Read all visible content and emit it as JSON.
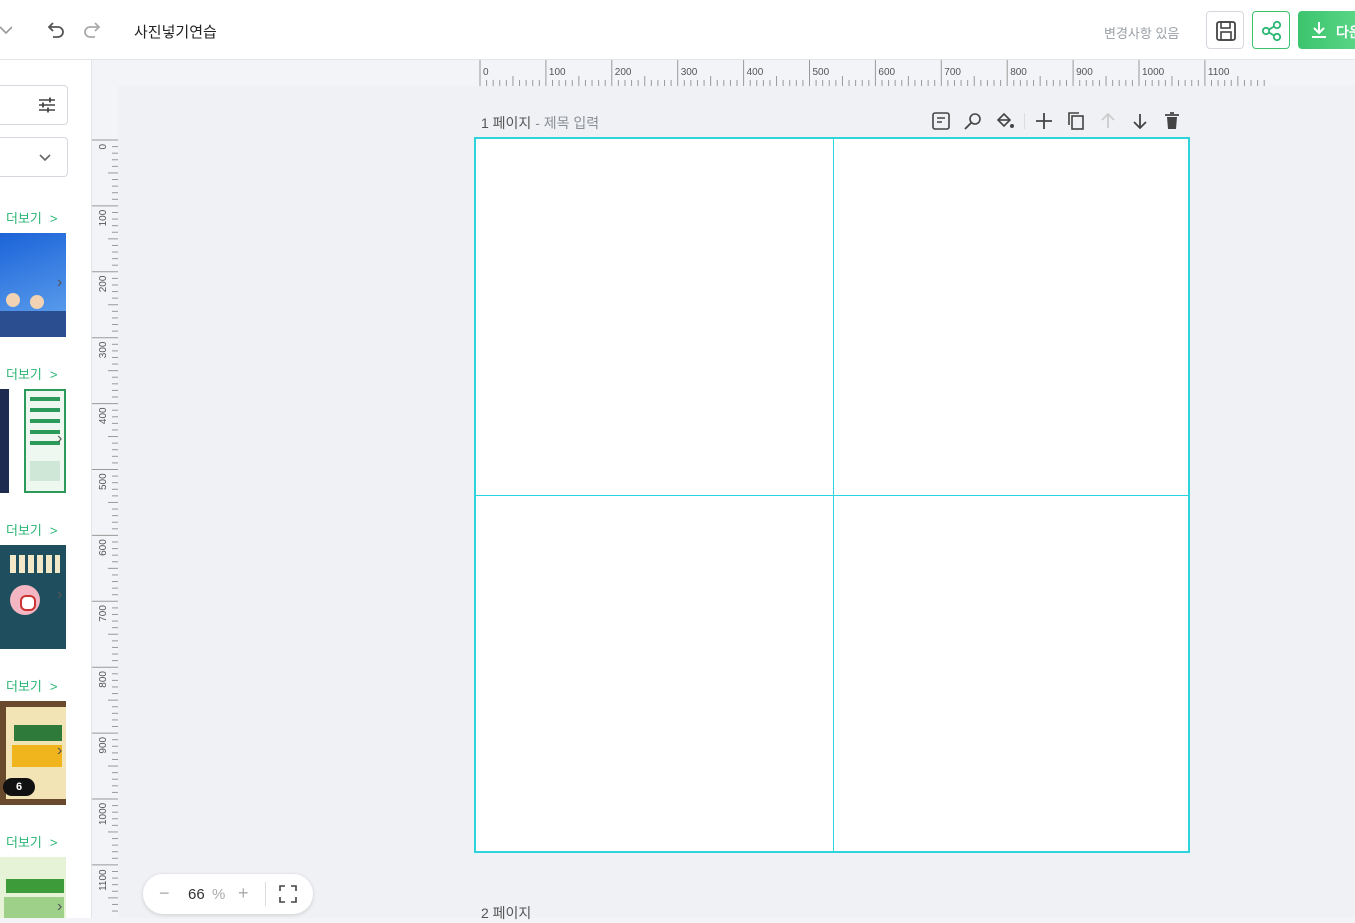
{
  "header": {
    "title": "사진넣기연습",
    "status": "변경사항 있음",
    "download_label": "다운"
  },
  "sidebar": {
    "more_label": "더보기",
    "badge_count": "6"
  },
  "rulers": {
    "horizontal": [
      "0",
      "100",
      "200",
      "300",
      "400",
      "500",
      "600",
      "700",
      "800",
      "900",
      "1000",
      "1100"
    ],
    "vertical": [
      "0",
      "100",
      "200",
      "300",
      "400",
      "500",
      "600",
      "700",
      "800",
      "900",
      "1000",
      "1100"
    ]
  },
  "page1": {
    "number": "1 페이지",
    "title_placeholder": "- 제목 입력"
  },
  "page2": {
    "number": "2 페이지"
  },
  "zoom": {
    "value": "66",
    "unit": "%"
  },
  "colors": {
    "accent": "#2bb673",
    "guide": "#2dd4dc"
  }
}
